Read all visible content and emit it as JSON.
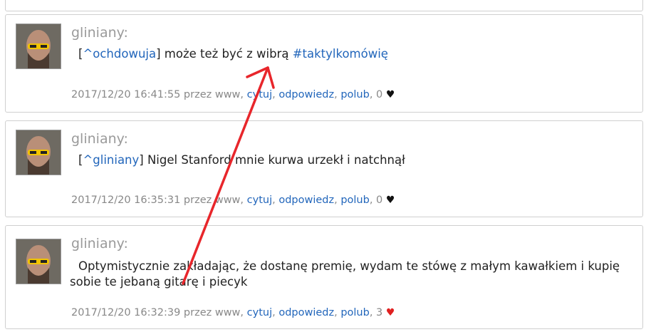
{
  "comments": [
    {
      "author": "gliniany:",
      "reply_to": "^ochdowuja",
      "text_after": " może też być z wibrą ",
      "hashtag": "#taktylkomówię",
      "date": "2017/12/20 16:41:55",
      "via": "przez www,",
      "cite": "cytuj",
      "reply": "odpowiedz",
      "like": "polub",
      "likes": "0",
      "heart": "♥",
      "heart_color": "#111111"
    },
    {
      "author": "gliniany:",
      "reply_to": "^gliniany",
      "text_after": " Nigel Stanford mnie kurwa urzekł i natchnął",
      "date": "2017/12/20 16:35:31",
      "via": "przez www,",
      "cite": "cytuj",
      "reply": "odpowiedz",
      "like": "polub",
      "likes": "0",
      "heart": "♥",
      "heart_color": "#111111"
    },
    {
      "author": "gliniany:",
      "text": "Optymistycznie zakładając, że dostanę premię, wydam te stówę z małym kawałkiem i kupię sobie te jebaną gitarę i piecyk",
      "date": "2017/12/20 16:32:39",
      "via": "przez www,",
      "cite": "cytuj",
      "reply": "odpowiedz",
      "like": "polub",
      "likes": "3",
      "heart": "♥",
      "heart_color": "#e02020"
    }
  ],
  "annotation": {
    "type": "red-arrow",
    "color": "#e8262b"
  },
  "colors": {
    "link": "#2266bb",
    "meta": "#888888",
    "author": "#9a9a9a",
    "border": "#cfcfcf"
  }
}
